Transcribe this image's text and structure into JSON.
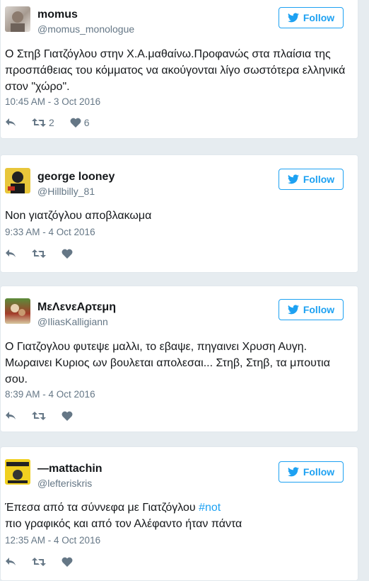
{
  "tweets": [
    {
      "name": "momus",
      "handle": "@momus_monologue",
      "follow_label": "Follow",
      "text": "Ο Στηβ Γιατζόγλου στην Χ.Α.μαθαίνω.Προφανώς στα πλαίσια της προσπάθειας του κόμματος να ακούγονται λίγο σωστότερα ελληνικά στον \"χώρο\".",
      "time": "10:45 AM - 3 Oct 2016",
      "retweets": "2",
      "likes": "6"
    },
    {
      "name": "george looney",
      "handle": "@Hillbilly_81",
      "follow_label": "Follow",
      "text": "Non γιατζόγλου αποβλακωμα",
      "time": "9:33 AM - 4 Oct 2016",
      "retweets": "",
      "likes": ""
    },
    {
      "name": "ΜεΛενεΑρτεμη",
      "handle": "@IliasKalligiann",
      "follow_label": "Follow",
      "text": "Ο Γιατζογλου φυτεψε μαλλι, το εβαψε, πηγαινει Χρυση Αυγη. Μωραινει Κυριος ων βουλεται απολεσαι... Στηβ, Στηβ, τα μπουτια σου.",
      "time": "8:39 AM - 4 Oct 2016",
      "retweets": "",
      "likes": ""
    },
    {
      "name": "—mattachin",
      "handle": "@lefteriskris",
      "follow_label": "Follow",
      "text_line1": "Έπεσα από τα σύννεφα με Γιατζόγλου ",
      "hashtag": "#not",
      "text_line2": "πιο γραφικός και από τον Αλέφαντο ήταν πάντα",
      "time": "12:35 AM - 4 Oct 2016",
      "retweets": "",
      "likes": ""
    }
  ],
  "colors": {
    "accent": "#1da1f2",
    "muted": "#657786",
    "text": "#14171a",
    "background": "#e6ecf0"
  },
  "icons": [
    "twitter-bird-icon",
    "reply-icon",
    "retweet-icon",
    "like-icon"
  ]
}
